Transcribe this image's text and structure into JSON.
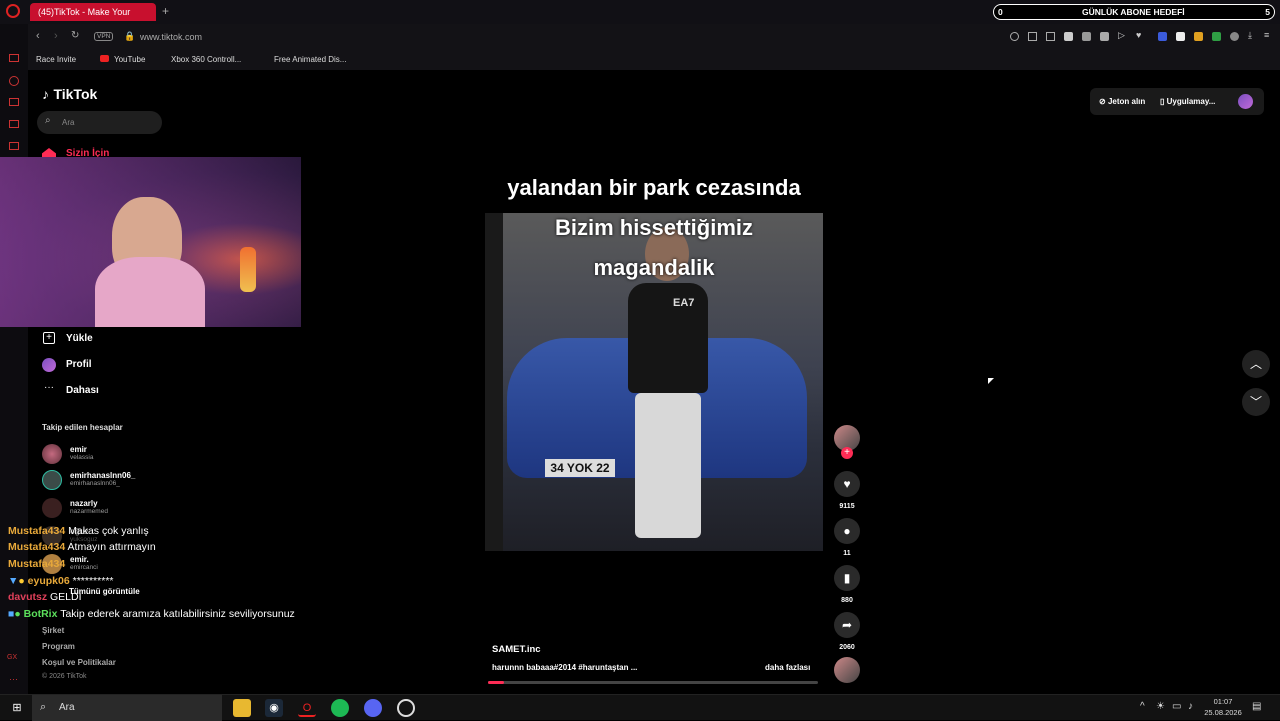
{
  "browser": {
    "tab_title": "(45)TikTok - Make Your",
    "url": "www.tiktok.com",
    "vpn_label": "VPN",
    "bookmarks": [
      "Race Invite",
      "YouTube",
      "Xbox 360 Controll...",
      "Free Animated Dis..."
    ],
    "subgoal": {
      "count": "0",
      "label": "GÜNLÜK ABONE HEDEFİ",
      "target": "5"
    }
  },
  "tiktok": {
    "logo": "TikTok",
    "search_placeholder": "Ara",
    "nav": {
      "for_you": "Sizin İçin",
      "upload": "Yükle",
      "profile": "Profil",
      "more": "Dahası"
    },
    "following_header": "Takip edilen hesaplar",
    "following": [
      {
        "name": "emir",
        "handle": "velassia"
      },
      {
        "name": "emirhanaslnn06_",
        "handle": "emirhanaslnn06_"
      },
      {
        "name": "nazarly",
        "handle": "nazarmemed"
      },
      {
        "name": "oğuz",
        "handle": "yuksoguz"
      },
      {
        "name": "emir.",
        "handle": "emircanci"
      }
    ],
    "see_all": "Tümünü görüntüle",
    "footer": {
      "company": "Şirket",
      "program": "Program",
      "terms": "Koşul ve Politikalar",
      "copyright": "© 2026 TikTok"
    },
    "top_right": {
      "coins": "Jeton alın",
      "app": "Uygulamay..."
    },
    "video": {
      "caption_top": "yalandan bir park cezasında",
      "caption_line1": "Bizim hissettiğimiz",
      "caption_line2": "magandalik",
      "plate": "34 YOK 22",
      "shirt": "EA7",
      "author": "SAMET.inc",
      "description": "harunnn babaaa#2014 #haruntaştan ...",
      "more": "daha fazlası",
      "likes": "9115",
      "comments": "11",
      "saves": "880",
      "shares": "2060"
    }
  },
  "chat": [
    {
      "user": "Mustafa434",
      "msg": "Makas çok yanlış",
      "color": "#e8a93a"
    },
    {
      "user": "Mustafa434",
      "msg": "Atmayın attırmayın",
      "color": "#e8a93a"
    },
    {
      "user": "Mustafa434",
      "msg": "",
      "color": "#e8a93a"
    },
    {
      "user": "eyupk06",
      "msg": "**********",
      "color": "#e8a93a"
    },
    {
      "user": "davutsz",
      "msg": "GELDİ",
      "color": "#e0405a"
    },
    {
      "user": "BotRix",
      "msg": "Takip ederek aramıza katılabilirsiniz seviliyorsunuz",
      "color": "#5ce05c"
    }
  ],
  "taskbar": {
    "search": "Ara",
    "time": "01:07",
    "date": "25.08.2026"
  }
}
